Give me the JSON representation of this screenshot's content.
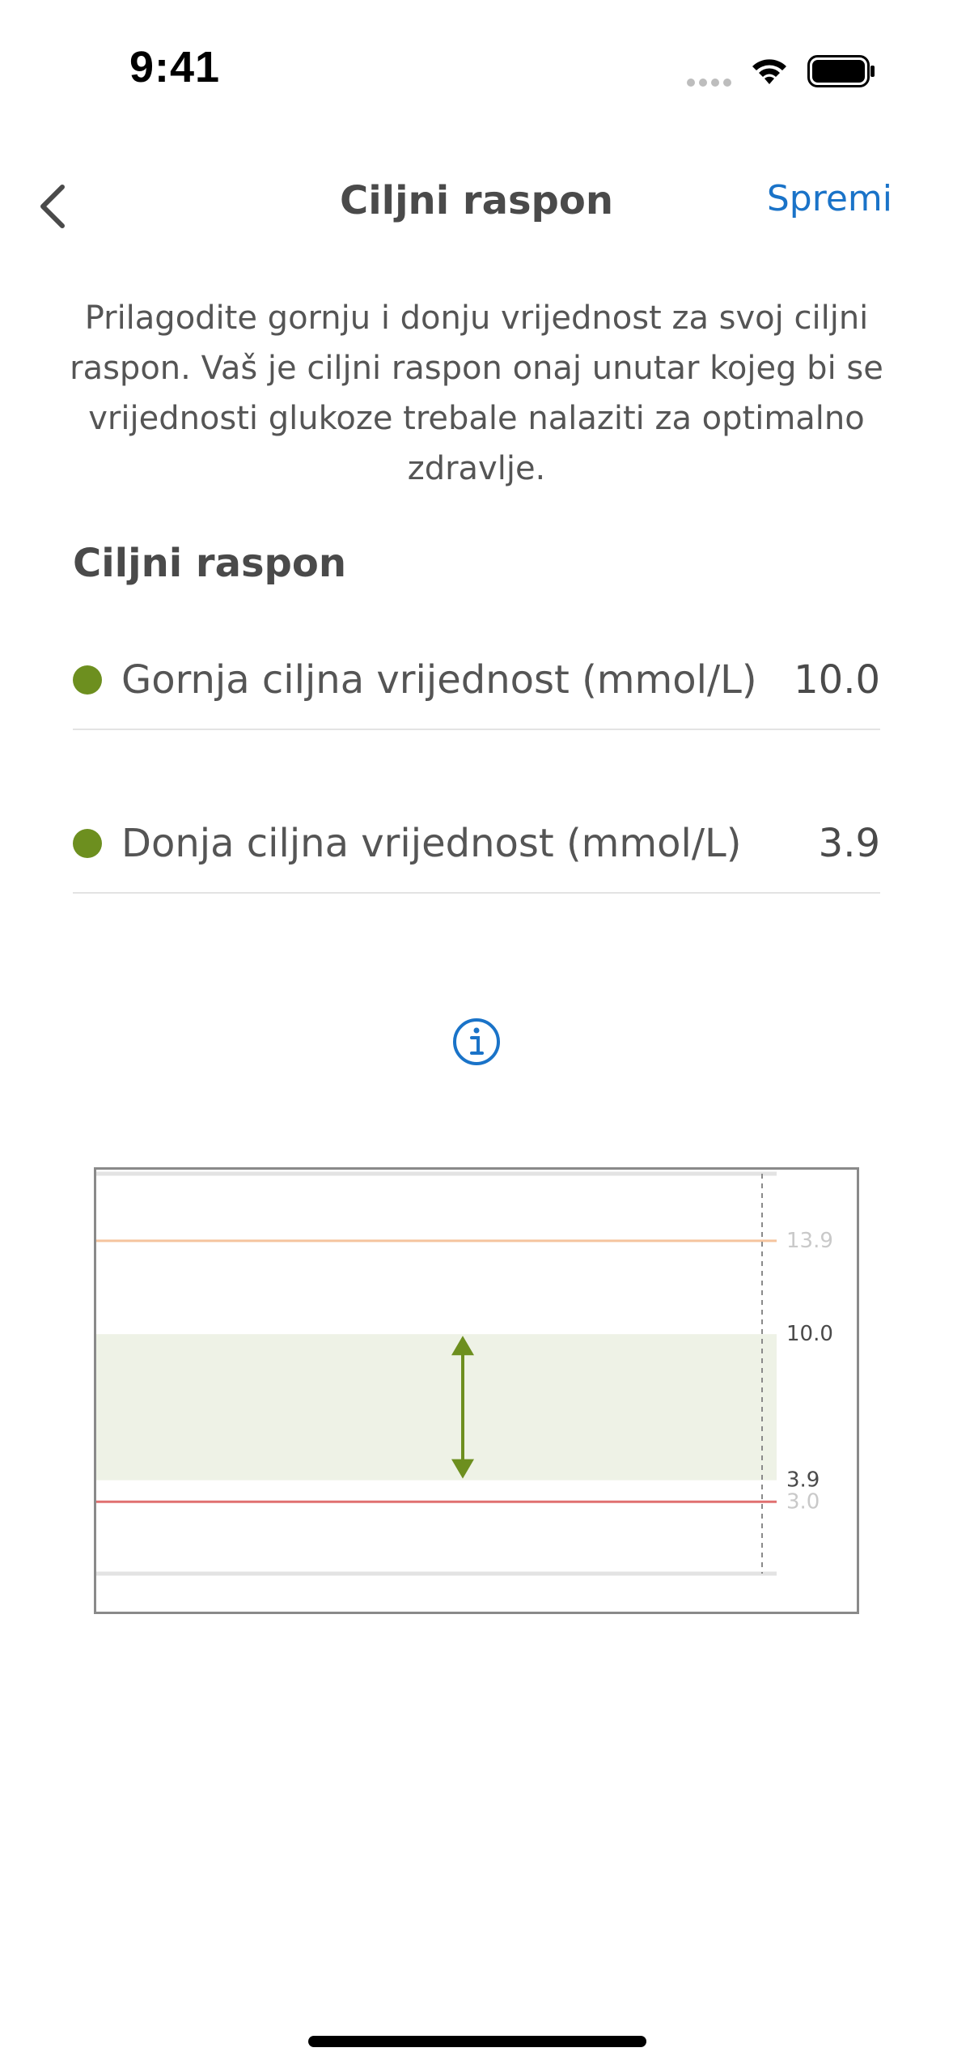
{
  "status_bar": {
    "time": "9:41",
    "icons": [
      "cellular-signal-icon",
      "wifi-icon",
      "battery-icon"
    ]
  },
  "nav": {
    "back_icon": "chevron-left-icon",
    "title": "Ciljni raspon",
    "save_label": "Spremi"
  },
  "description": "Prilagodite gornju i donju vrijednost za svoj ciljni raspon. Vaš je ciljni raspon onaj unutar kojeg bi se vrijednosti glukoze trebale nalaziti za optimalno zdravlje.",
  "section": {
    "title": "Ciljni raspon"
  },
  "rows": [
    {
      "label": "Gornja ciljna vrijednost (mmol/L)",
      "value": "10.0"
    },
    {
      "label": "Donja ciljna vrijednost (mmol/L)",
      "value": "3.9"
    }
  ],
  "info_icon": "info-icon",
  "colors": {
    "accent": "#1a73c8",
    "target_dot": "#6d8f1f",
    "target_band": "#eef2e6",
    "high_line": "#f5c49e",
    "low_line": "#e07070"
  },
  "chart_data": {
    "type": "area",
    "y_ticks": [
      "13.9",
      "10.0",
      "3.9",
      "3.0"
    ],
    "ylim": [
      0,
      16.7
    ],
    "target_range": [
      3.9,
      10.0
    ],
    "high_threshold": 13.9,
    "low_threshold": 3.0,
    "grid": false
  }
}
